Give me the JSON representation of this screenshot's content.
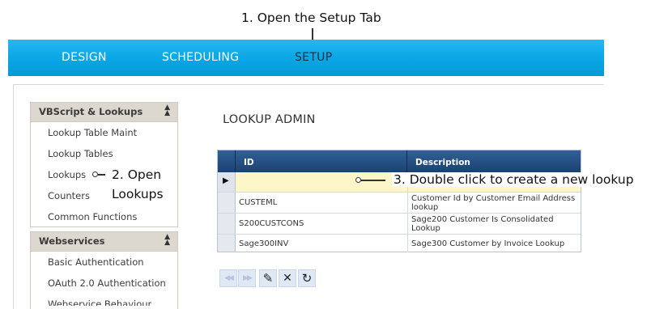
{
  "annotations": {
    "step1": "1. Open the Setup Tab",
    "step2_line1": "2. Open",
    "step2_line2": "Lookups",
    "step3": "3. Double click to create a new lookup"
  },
  "nav": {
    "tabs": [
      {
        "label": "DESIGN",
        "active": false
      },
      {
        "label": "SCHEDULING",
        "active": false
      },
      {
        "label": "SETUP",
        "active": true
      }
    ],
    "bar_color": "#0aa7e6"
  },
  "sidebar": {
    "panels": [
      {
        "title": "VBScript & Lookups",
        "items": [
          "Lookup Table Maint",
          "Lookup Tables",
          "Lookups",
          "Counters",
          "Common Functions"
        ]
      },
      {
        "title": "Webservices",
        "items": [
          "Basic Authentication",
          "OAuth 2.0 Authentication",
          "Webservice Behaviour"
        ]
      }
    ],
    "collapse_icon": "double-chevron-up-icon"
  },
  "main": {
    "title": "LOOKUP ADMIN",
    "grid": {
      "columns": [
        "ID",
        "Description"
      ],
      "new_row": {
        "id": "",
        "description": ""
      },
      "rows": [
        {
          "id": "CUSTEML",
          "description": "Customer Id by Customer Email Address lookup"
        },
        {
          "id": "S200CUSTCONS",
          "description": "Sage200 Customer Is Consolidated Lookup"
        },
        {
          "id": "Sage300INV",
          "description": "Sage300 Customer by Invoice Lookup"
        }
      ],
      "header_color": "#24507f",
      "new_row_color": "#fdf6c8"
    },
    "toolbar": [
      {
        "name": "first-page-icon",
        "glyph": "◀◀",
        "enabled": false
      },
      {
        "name": "next-page-icon",
        "glyph": "▶▶",
        "enabled": false
      },
      {
        "name": "edit-pencil-icon",
        "glyph": "✎",
        "enabled": true
      },
      {
        "name": "delete-x-icon",
        "glyph": "✕",
        "enabled": true
      },
      {
        "name": "refresh-icon",
        "glyph": "↻",
        "enabled": true
      }
    ]
  }
}
